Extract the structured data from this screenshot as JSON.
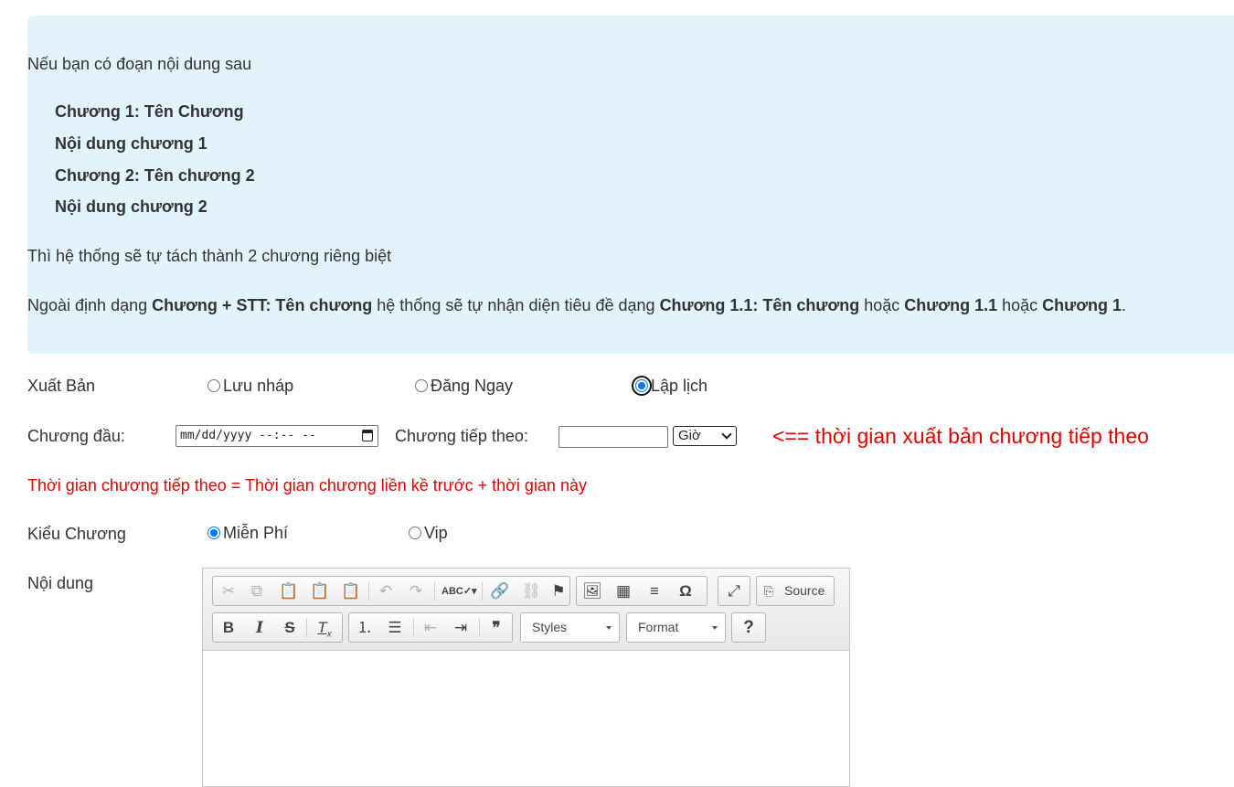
{
  "info": {
    "intro": "Nếu bạn có đoạn nội dung sau",
    "examples": [
      "Chương 1: Tên Chương",
      "Nội dung chương 1",
      "Chương 2: Tên chương 2",
      "Nội dung chương 2"
    ],
    "result": "Thì hệ thống sẽ tự tách thành 2 chương riêng biệt",
    "note": {
      "p1": "Ngoài định dạng ",
      "b1": "Chương + STT: Tên chương",
      "p2": " hệ thống sẽ tự nhận diện tiêu đề dạng ",
      "b2": "Chương 1.1: Tên chương",
      "p3": " hoặc ",
      "b3": "Chương 1.1",
      "p4": " hoặc ",
      "b4": "Chương 1",
      "p5": "."
    }
  },
  "publish": {
    "label": "Xuất Bản",
    "options": [
      "Lưu nháp",
      "Đăng Ngay",
      "Lập lịch"
    ],
    "selected": "Lập lịch"
  },
  "schedule": {
    "first_label": "Chương đầu:",
    "first_placeholder": "mm/dd/yyyy --:-- --",
    "next_label": "Chương tiếp theo:",
    "next_value": "",
    "unit_selected": "Giờ",
    "hint": "<== thời gian xuất bản chương tiếp theo",
    "formula": "Thời gian chương tiếp theo = Thời gian chương liền kề trước + thời gian này"
  },
  "chapter_type": {
    "label": "Kiểu Chương",
    "options": [
      "Miễn Phí",
      "Vip"
    ],
    "selected": "Miễn Phí"
  },
  "content": {
    "label": "Nội dung",
    "source_label": "Source",
    "styles_label": "Styles",
    "format_label": "Format",
    "help_label": "?"
  },
  "colors": {
    "info_bg": "#e3f3fc",
    "accent_red": "#e00000",
    "radio_blue": "#0075ff"
  }
}
